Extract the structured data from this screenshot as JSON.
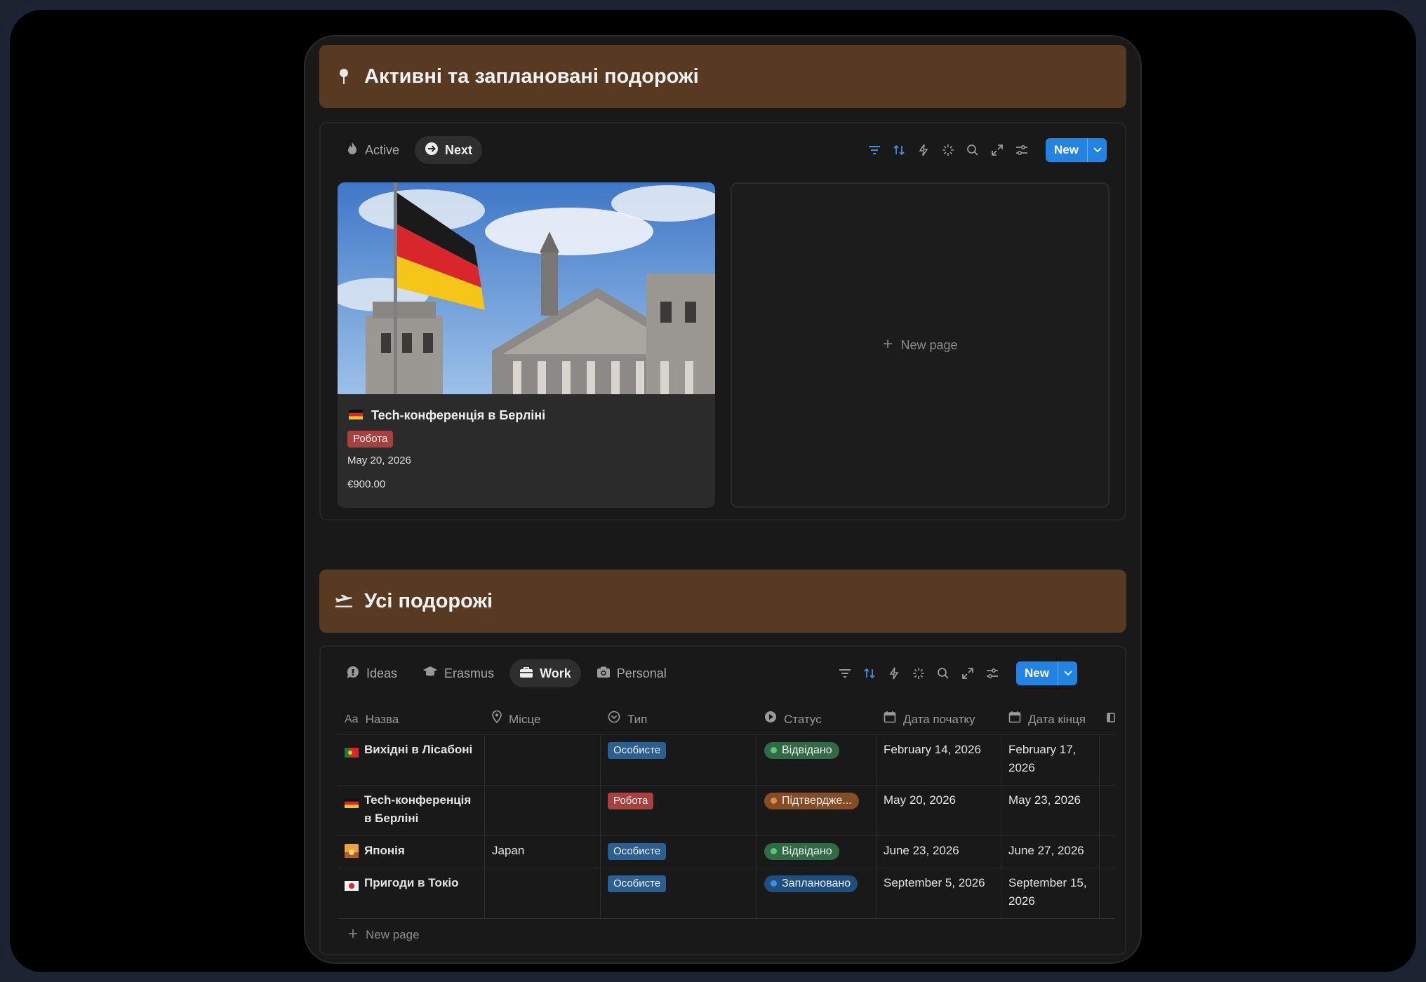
{
  "section1": {
    "title": "Активні та заплановані подорожі",
    "tabs": [
      {
        "label": "Active",
        "icon": "fire-icon",
        "active": false
      },
      {
        "label": "Next",
        "icon": "arrow-circle-right-icon",
        "active": true
      }
    ],
    "new_label": "New",
    "card": {
      "title": "Tech-конференція в Берліні",
      "flag": "germany-flag-icon",
      "tag": "Робота",
      "date": "May 20, 2026",
      "price": "€900.00"
    },
    "new_page_label": "New page"
  },
  "section2": {
    "title": "Усі подорожі",
    "tabs": [
      {
        "label": "Ideas",
        "icon": "lightbulb-chat-icon",
        "active": false
      },
      {
        "label": "Erasmus",
        "icon": "graduation-cap-icon",
        "active": false
      },
      {
        "label": "Work",
        "icon": "briefcase-icon",
        "active": true
      },
      {
        "label": "Personal",
        "icon": "camera-icon",
        "active": false
      }
    ],
    "new_label": "New",
    "columns": [
      "Назва",
      "Місце",
      "Тип",
      "Статус",
      "Дата початку",
      "Дата кінця"
    ],
    "col_prefix": "Aa",
    "rows": [
      {
        "name": "Вихідні в Лісабоні",
        "place": "",
        "type": "Особисте",
        "status": "Відвідано",
        "start": "February 14, 2026",
        "end": "February 17, 2026"
      },
      {
        "name": "Tech-конференція в Берліні",
        "place": "",
        "type": "Робота",
        "status": "Підтвердже...",
        "start": "May 20, 2026",
        "end": "May 23, 2026"
      },
      {
        "name": "Японія",
        "place": "Japan",
        "type": "Особисте",
        "status": "Відвідано",
        "start": "June 23, 2026",
        "end": "June 27, 2026"
      },
      {
        "name": "Пригоди в Токіо",
        "place": "",
        "type": "Особисте",
        "status": "Заплановано",
        "start": "September 5, 2026",
        "end": "September 15, 2026"
      }
    ],
    "new_page_label": "New page"
  },
  "colors": {
    "banner": "#583a23",
    "accent": "#2383e2",
    "tag_red": "#a8403f",
    "tag_blue": "#2c5f91"
  }
}
